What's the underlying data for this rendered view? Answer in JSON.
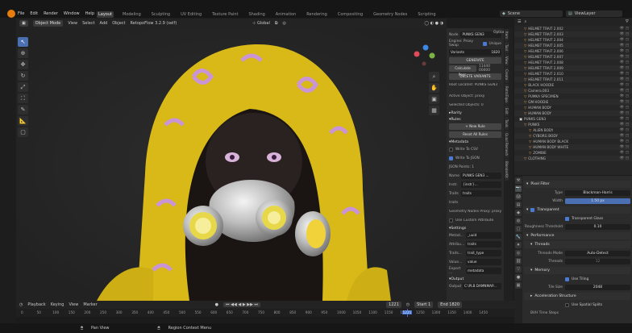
{
  "menubar": {
    "menus": [
      "File",
      "Edit",
      "Render",
      "Window",
      "Help"
    ],
    "workspaces": [
      "Layout",
      "Modeling",
      "Sculpting",
      "UV Editing",
      "Texture Paint",
      "Shading",
      "Animation",
      "Rendering",
      "Compositing",
      "Geometry Nodes",
      "Scripting"
    ],
    "active_workspace": "Layout",
    "scene": "Scene",
    "view_layer": "ViewLayer"
  },
  "viewport_header": {
    "mode": "Object Mode",
    "menus": [
      "View",
      "Select",
      "Add",
      "Object"
    ],
    "object_label": "RetopoFlow 3.2.9 (self)",
    "orientation": "Global",
    "options": "Options"
  },
  "npanel": {
    "node_label": "Node",
    "node_value": "PUNKS GEN3",
    "engine_label": "Engine: Proxy Swap",
    "unique_label": "Unique",
    "variants_label": "Variants",
    "variants_value": "1820",
    "generate_label": "GENERATE",
    "calculate_label": "Calculate Poss.",
    "calculate_value": "11440 00000",
    "delete_label": "DELETE VARIANTS",
    "root_label": "Root Located: PUNKS GEN3",
    "active_object": "Active Object: proxy",
    "selected_objects": "Selected Objects: 0",
    "rarity_label": "Rarity",
    "rules_label": "Rules",
    "new_rule": "+ New Rule",
    "reset_rules": "Reset All Rules",
    "metadata_label": "Metadata",
    "write_csv": "Write To CSV",
    "write_json": "Write To JSON",
    "json_points": "JSON Points: 1",
    "name_label": "Name",
    "name_value": "PUNKS GEN3 ...",
    "instr_label": "Instr.",
    "instr_value": "{instr}...",
    "traits_label": "Traits",
    "traits_value": "traits",
    "traits_note": "traits",
    "gn_proxy": "Geometry Nodes Proxy: proxy",
    "custom_attr": "Use Custom Attribute",
    "settings_label": "Settings",
    "settings_rows": [
      {
        "label": "Metad...",
        "value": "_uuid"
      },
      {
        "label": "Attribu...",
        "value": "traits"
      },
      {
        "label": "Traits...",
        "value": "trait_type"
      },
      {
        "label": "Value...",
        "value": "value"
      },
      {
        "label": "Export ...",
        "value": "metadata"
      }
    ],
    "output_label": "Output",
    "output_row_label": "Output",
    "output_row_value": "C:\\PLB DAMNMAP..."
  },
  "npanel_tabs": [
    "Item",
    "Tool",
    "View",
    "Create",
    "RetroTopo",
    "Edit",
    "Tools",
    "Quad Remesh",
    "BlenderKit"
  ],
  "outliner": {
    "rows": [
      {
        "name": "HELMET TRAIT 2.002",
        "depth": 1
      },
      {
        "name": "HELMET TRAIT 2.003",
        "depth": 1
      },
      {
        "name": "HELMET TRAIT 2.004",
        "depth": 1
      },
      {
        "name": "HELMET TRAIT 2.005",
        "depth": 1
      },
      {
        "name": "HELMET TRAIT 2.006",
        "depth": 1
      },
      {
        "name": "HELMET TRAIT 2.007",
        "depth": 1
      },
      {
        "name": "HELMET TRAIT 2.008",
        "depth": 1
      },
      {
        "name": "HELMET TRAIT 2.009",
        "depth": 1
      },
      {
        "name": "HELMET TRAIT 2.010",
        "depth": 1
      },
      {
        "name": "HELMET TRAIT 2.011",
        "depth": 1
      },
      {
        "name": "BLACK HOODIE",
        "depth": 1
      },
      {
        "name": "Camera.003",
        "depth": 1
      },
      {
        "name": "PUMKA SPECIMEN",
        "depth": 1
      },
      {
        "name": "GM HOODIE",
        "depth": 1
      },
      {
        "name": "HUMAN BODY",
        "depth": 1
      },
      {
        "name": "HUMAN BODY",
        "depth": 1
      },
      {
        "name": "PUNKS GEN3",
        "depth": 0
      },
      {
        "name": "PUNKS",
        "depth": 1
      },
      {
        "name": "ALIEN BODY",
        "depth": 2
      },
      {
        "name": "CYBORG BODY",
        "depth": 2
      },
      {
        "name": "HUMAN BODY BLACK",
        "depth": 2
      },
      {
        "name": "HUMAN BODY WHITE",
        "depth": 2
      },
      {
        "name": "ZOMBIE",
        "depth": 2
      },
      {
        "name": "CLOTHING",
        "depth": 1
      }
    ]
  },
  "properties": {
    "pixel_filter": "Pixel Filter",
    "type_label": "Type",
    "type_value": "Blackman-Harris",
    "width_label": "Width",
    "width_value": "1.50 px",
    "transparent": "Transparent",
    "transparent_glass": "Transparent Glass",
    "roughness_label": "Roughness Threshold",
    "roughness_value": "0.10",
    "performance": "Performance",
    "threads": "Threads",
    "threads_mode_label": "Threads Mode",
    "threads_mode_value": "Auto-Detect",
    "threads_label": "Threads",
    "threads_value": "12",
    "memory": "Memory",
    "use_tiling": "Use Tiling",
    "tile_size_label": "Tile Size",
    "tile_size_value": "2048",
    "accel": "Acceleration Structure",
    "spatial_splits": "Use Spatial Splits",
    "bvh": "BVH Time Steps"
  },
  "timeline": {
    "menus": [
      "Playback",
      "Keying",
      "View",
      "Marker"
    ],
    "current_frame": "1221",
    "start_label": "Start",
    "start_value": "1",
    "end_label": "End",
    "end_value": "1820",
    "ruler_ticks": [
      "0",
      "50",
      "100",
      "150",
      "200",
      "250",
      "300",
      "350",
      "400",
      "450",
      "500",
      "550",
      "600",
      "650",
      "700",
      "750",
      "800",
      "850",
      "900",
      "950",
      "1000",
      "1050",
      "1100",
      "1150",
      "1200",
      "1250",
      "1300",
      "1350",
      "1400",
      "1450"
    ],
    "playhead_label": "1221"
  },
  "statusbar": {
    "pan_view": "Pan View",
    "region_menu": "Region Context Menu"
  },
  "colors": {
    "accent": "#4a7ad3",
    "hoodie_yellow": "#e3c21c",
    "blender_orange": "#e87d0d"
  }
}
